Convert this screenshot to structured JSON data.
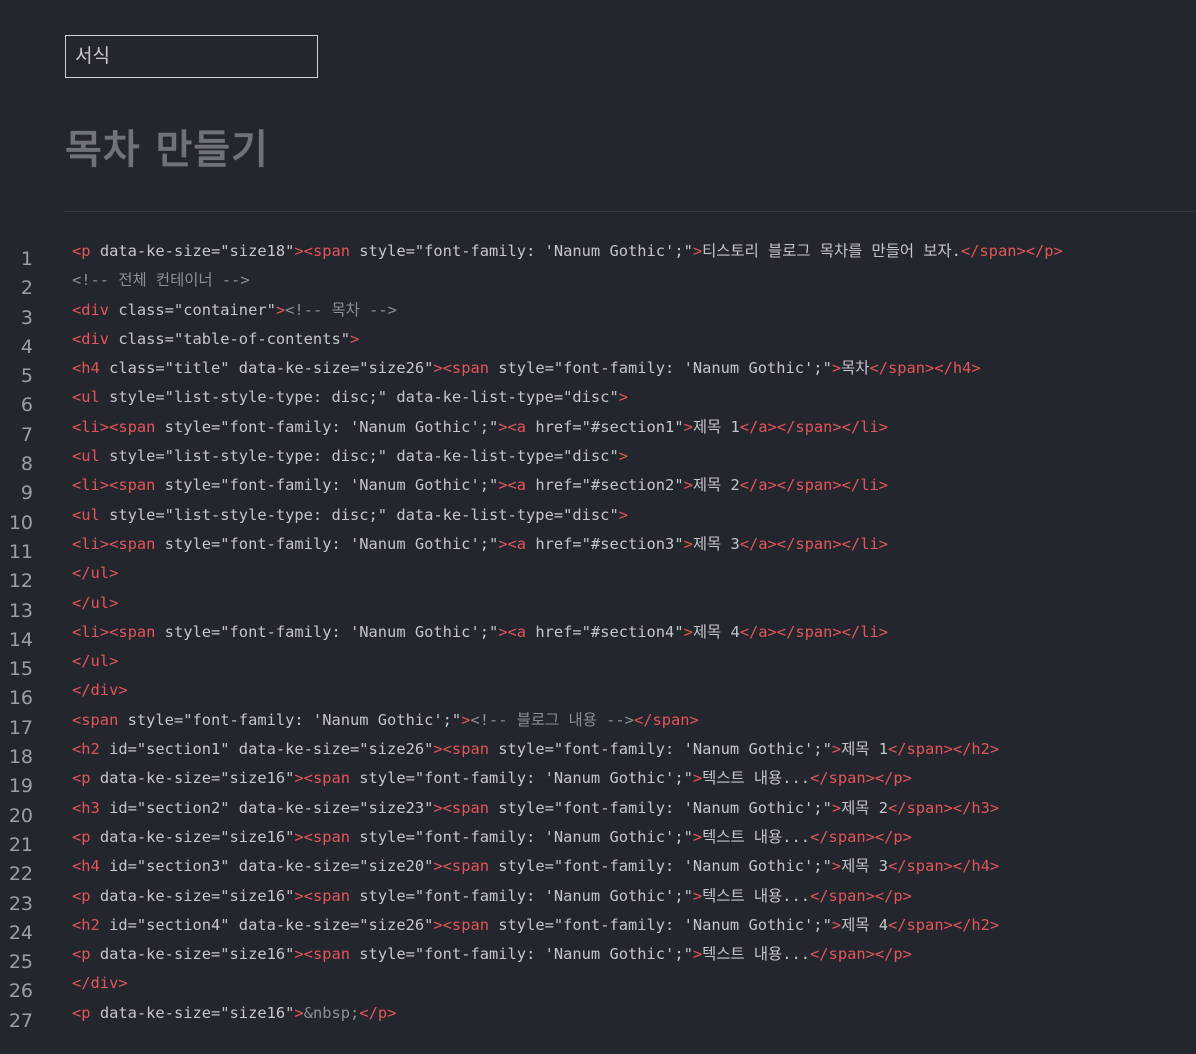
{
  "format_select": {
    "label": "서식"
  },
  "page_title": "목차 만들기",
  "colors": {
    "background": "#24262d",
    "tag": "#e2555a",
    "text": "#c3c6cb",
    "comment": "#8b9096",
    "line_number": "#9aa0a6"
  },
  "code_lines": [
    {
      "n": "1",
      "tokens": [
        {
          "t": "tag",
          "v": "<p"
        },
        {
          "t": "attr",
          "v": " data-ke-size=\"size18\""
        },
        {
          "t": "tag",
          "v": "><span"
        },
        {
          "t": "attr",
          "v": " style=\"font-family: 'Nanum Gothic';\""
        },
        {
          "t": "tag",
          "v": ">"
        },
        {
          "t": "text",
          "v": "티스토리 블로그 목차를 만들어 보자."
        },
        {
          "t": "tag",
          "v": "</span></p>"
        }
      ]
    },
    {
      "n": "2",
      "tokens": [
        {
          "t": "comment",
          "v": "<!-- 전체 컨테이너 -->"
        }
      ]
    },
    {
      "n": "3",
      "tokens": [
        {
          "t": "tag",
          "v": "<div"
        },
        {
          "t": "attr",
          "v": " class=\"container\""
        },
        {
          "t": "tag",
          "v": ">"
        },
        {
          "t": "comment",
          "v": "<!-- 목차 -->"
        }
      ]
    },
    {
      "n": "4",
      "tokens": [
        {
          "t": "tag",
          "v": "<div"
        },
        {
          "t": "attr",
          "v": " class=\"table-of-contents\""
        },
        {
          "t": "tag",
          "v": ">"
        }
      ]
    },
    {
      "n": "5",
      "tokens": [
        {
          "t": "tag",
          "v": "<h4"
        },
        {
          "t": "attr",
          "v": " class=\"title\" data-ke-size=\"size26\""
        },
        {
          "t": "tag",
          "v": "><span"
        },
        {
          "t": "attr",
          "v": " style=\"font-family: 'Nanum Gothic';\""
        },
        {
          "t": "tag",
          "v": ">"
        },
        {
          "t": "text",
          "v": "목차"
        },
        {
          "t": "tag",
          "v": "</span></h4>"
        }
      ]
    },
    {
      "n": "6",
      "tokens": [
        {
          "t": "tag",
          "v": "<ul"
        },
        {
          "t": "attr",
          "v": " style=\"list-style-type: disc;\" data-ke-list-type=\"disc\""
        },
        {
          "t": "tag",
          "v": ">"
        }
      ]
    },
    {
      "n": "7",
      "tokens": [
        {
          "t": "tag",
          "v": "<li><span"
        },
        {
          "t": "attr",
          "v": " style=\"font-family: 'Nanum Gothic';\""
        },
        {
          "t": "tag",
          "v": "><a"
        },
        {
          "t": "attr",
          "v": " href=\"#section1\""
        },
        {
          "t": "tag",
          "v": ">"
        },
        {
          "t": "text",
          "v": "제목 1"
        },
        {
          "t": "tag",
          "v": "</a></span></li>"
        }
      ]
    },
    {
      "n": "8",
      "tokens": [
        {
          "t": "tag",
          "v": "<ul"
        },
        {
          "t": "attr",
          "v": " style=\"list-style-type: disc;\" data-ke-list-type=\"disc\""
        },
        {
          "t": "tag",
          "v": ">"
        }
      ]
    },
    {
      "n": "9",
      "tokens": [
        {
          "t": "tag",
          "v": "<li><span"
        },
        {
          "t": "attr",
          "v": " style=\"font-family: 'Nanum Gothic';\""
        },
        {
          "t": "tag",
          "v": "><a"
        },
        {
          "t": "attr",
          "v": " href=\"#section2\""
        },
        {
          "t": "tag",
          "v": ">"
        },
        {
          "t": "text",
          "v": "제목 2"
        },
        {
          "t": "tag",
          "v": "</a></span></li>"
        }
      ]
    },
    {
      "n": "10",
      "tokens": [
        {
          "t": "tag",
          "v": "<ul"
        },
        {
          "t": "attr",
          "v": " style=\"list-style-type: disc;\" data-ke-list-type=\"disc\""
        },
        {
          "t": "tag",
          "v": ">"
        }
      ]
    },
    {
      "n": "11",
      "tokens": [
        {
          "t": "tag",
          "v": "<li><span"
        },
        {
          "t": "attr",
          "v": " style=\"font-family: 'Nanum Gothic';\""
        },
        {
          "t": "tag",
          "v": "><a"
        },
        {
          "t": "attr",
          "v": " href=\"#section3\""
        },
        {
          "t": "tag",
          "v": ">"
        },
        {
          "t": "text",
          "v": "제목 3"
        },
        {
          "t": "tag",
          "v": "</a></span></li>"
        }
      ]
    },
    {
      "n": "12",
      "tokens": [
        {
          "t": "tag",
          "v": "</ul>"
        }
      ]
    },
    {
      "n": "13",
      "tokens": [
        {
          "t": "tag",
          "v": "</ul>"
        }
      ]
    },
    {
      "n": "14",
      "tokens": [
        {
          "t": "tag",
          "v": "<li><span"
        },
        {
          "t": "attr",
          "v": " style=\"font-family: 'Nanum Gothic';\""
        },
        {
          "t": "tag",
          "v": "><a"
        },
        {
          "t": "attr",
          "v": " href=\"#section4\""
        },
        {
          "t": "tag",
          "v": ">"
        },
        {
          "t": "text",
          "v": "제목 4"
        },
        {
          "t": "tag",
          "v": "</a></span></li>"
        }
      ]
    },
    {
      "n": "15",
      "tokens": [
        {
          "t": "tag",
          "v": "</ul>"
        }
      ]
    },
    {
      "n": "16",
      "tokens": [
        {
          "t": "tag",
          "v": "</div>"
        }
      ]
    },
    {
      "n": "17",
      "tokens": [
        {
          "t": "tag",
          "v": "<span"
        },
        {
          "t": "attr",
          "v": " style=\"font-family: 'Nanum Gothic';\""
        },
        {
          "t": "tag",
          "v": ">"
        },
        {
          "t": "comment",
          "v": "<!-- 블로그 내용 -->"
        },
        {
          "t": "tag",
          "v": "</span>"
        }
      ]
    },
    {
      "n": "18",
      "tokens": [
        {
          "t": "tag",
          "v": "<h2"
        },
        {
          "t": "attr",
          "v": " id=\"section1\" data-ke-size=\"size26\""
        },
        {
          "t": "tag",
          "v": "><span"
        },
        {
          "t": "attr",
          "v": " style=\"font-family: 'Nanum Gothic';\""
        },
        {
          "t": "tag",
          "v": ">"
        },
        {
          "t": "text",
          "v": "제목 1"
        },
        {
          "t": "tag",
          "v": "</span></h2>"
        }
      ]
    },
    {
      "n": "19",
      "tokens": [
        {
          "t": "tag",
          "v": "<p"
        },
        {
          "t": "attr",
          "v": " data-ke-size=\"size16\""
        },
        {
          "t": "tag",
          "v": "><span"
        },
        {
          "t": "attr",
          "v": " style=\"font-family: 'Nanum Gothic';\""
        },
        {
          "t": "tag",
          "v": ">"
        },
        {
          "t": "text",
          "v": "텍스트 내용..."
        },
        {
          "t": "tag",
          "v": "</span></p>"
        }
      ]
    },
    {
      "n": "20",
      "tokens": [
        {
          "t": "tag",
          "v": "<h3"
        },
        {
          "t": "attr",
          "v": " id=\"section2\" data-ke-size=\"size23\""
        },
        {
          "t": "tag",
          "v": "><span"
        },
        {
          "t": "attr",
          "v": " style=\"font-family: 'Nanum Gothic';\""
        },
        {
          "t": "tag",
          "v": ">"
        },
        {
          "t": "text",
          "v": "제목 2"
        },
        {
          "t": "tag",
          "v": "</span></h3>"
        }
      ]
    },
    {
      "n": "21",
      "tokens": [
        {
          "t": "tag",
          "v": "<p"
        },
        {
          "t": "attr",
          "v": " data-ke-size=\"size16\""
        },
        {
          "t": "tag",
          "v": "><span"
        },
        {
          "t": "attr",
          "v": " style=\"font-family: 'Nanum Gothic';\""
        },
        {
          "t": "tag",
          "v": ">"
        },
        {
          "t": "text",
          "v": "텍스트 내용..."
        },
        {
          "t": "tag",
          "v": "</span></p>"
        }
      ]
    },
    {
      "n": "22",
      "tokens": [
        {
          "t": "tag",
          "v": "<h4"
        },
        {
          "t": "attr",
          "v": " id=\"section3\" data-ke-size=\"size20\""
        },
        {
          "t": "tag",
          "v": "><span"
        },
        {
          "t": "attr",
          "v": " style=\"font-family: 'Nanum Gothic';\""
        },
        {
          "t": "tag",
          "v": ">"
        },
        {
          "t": "text",
          "v": "제목 3"
        },
        {
          "t": "tag",
          "v": "</span></h4>"
        }
      ]
    },
    {
      "n": "23",
      "tokens": [
        {
          "t": "tag",
          "v": "<p"
        },
        {
          "t": "attr",
          "v": " data-ke-size=\"size16\""
        },
        {
          "t": "tag",
          "v": "><span"
        },
        {
          "t": "attr",
          "v": " style=\"font-family: 'Nanum Gothic';\""
        },
        {
          "t": "tag",
          "v": ">"
        },
        {
          "t": "text",
          "v": "텍스트 내용..."
        },
        {
          "t": "tag",
          "v": "</span></p>"
        }
      ]
    },
    {
      "n": "24",
      "tokens": [
        {
          "t": "tag",
          "v": "<h2"
        },
        {
          "t": "attr",
          "v": " id=\"section4\" data-ke-size=\"size26\""
        },
        {
          "t": "tag",
          "v": "><span"
        },
        {
          "t": "attr",
          "v": " style=\"font-family: 'Nanum Gothic';\""
        },
        {
          "t": "tag",
          "v": ">"
        },
        {
          "t": "text",
          "v": "제목 4"
        },
        {
          "t": "tag",
          "v": "</span></h2>"
        }
      ]
    },
    {
      "n": "25",
      "tokens": [
        {
          "t": "tag",
          "v": "<p"
        },
        {
          "t": "attr",
          "v": " data-ke-size=\"size16\""
        },
        {
          "t": "tag",
          "v": "><span"
        },
        {
          "t": "attr",
          "v": " style=\"font-family: 'Nanum Gothic';\""
        },
        {
          "t": "tag",
          "v": ">"
        },
        {
          "t": "text",
          "v": "텍스트 내용..."
        },
        {
          "t": "tag",
          "v": "</span></p>"
        }
      ]
    },
    {
      "n": "26",
      "tokens": [
        {
          "t": "tag",
          "v": "</div>"
        }
      ]
    },
    {
      "n": "27",
      "tokens": [
        {
          "t": "tag",
          "v": "<p"
        },
        {
          "t": "attr",
          "v": " data-ke-size=\"size16\""
        },
        {
          "t": "tag",
          "v": ">"
        },
        {
          "t": "comment",
          "v": "&nbsp;"
        },
        {
          "t": "tag",
          "v": "</p>"
        }
      ]
    }
  ]
}
